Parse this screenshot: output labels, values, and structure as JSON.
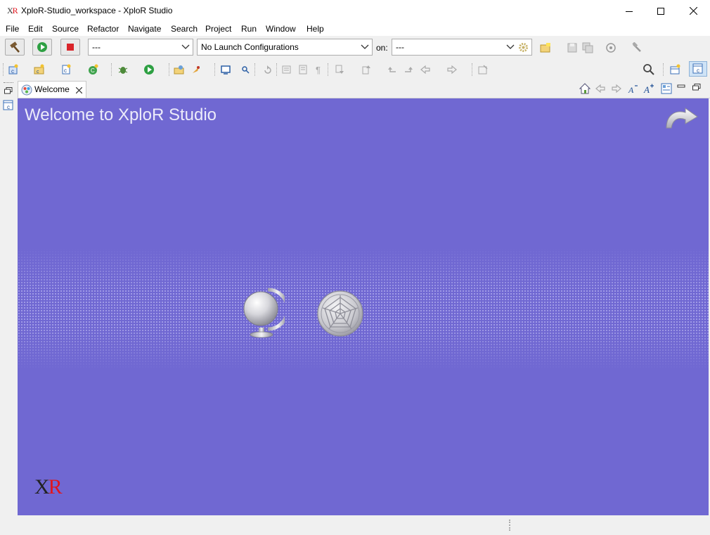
{
  "window": {
    "app_logo_x": "X",
    "app_logo_r": "R",
    "title": "XploR-Studio_workspace - XploR Studio"
  },
  "menu": [
    "File",
    "Edit",
    "Source",
    "Refactor",
    "Navigate",
    "Search",
    "Project",
    "Run",
    "Window",
    "Help"
  ],
  "toolbar": {
    "build_config_value": "---",
    "launch_config_value": "No Launch Configurations",
    "on_label": "on:",
    "target_value": "---"
  },
  "editor": {
    "tab_label": "Welcome"
  },
  "welcome": {
    "title": "Welcome to XploR Studio",
    "logo_x": "X",
    "logo_r": "R"
  },
  "icons": {
    "titlebar": [
      "minimize-icon",
      "maximize-icon",
      "close-icon"
    ],
    "welcome_items": [
      "overview-globe-icon",
      "tutorials-web-icon"
    ],
    "workbench_arrow": "go-to-workbench-icon"
  },
  "colors": {
    "welcome_background": "#7068d2",
    "welcome_title": "#ecebfa",
    "logo_red": "#e0161e"
  }
}
